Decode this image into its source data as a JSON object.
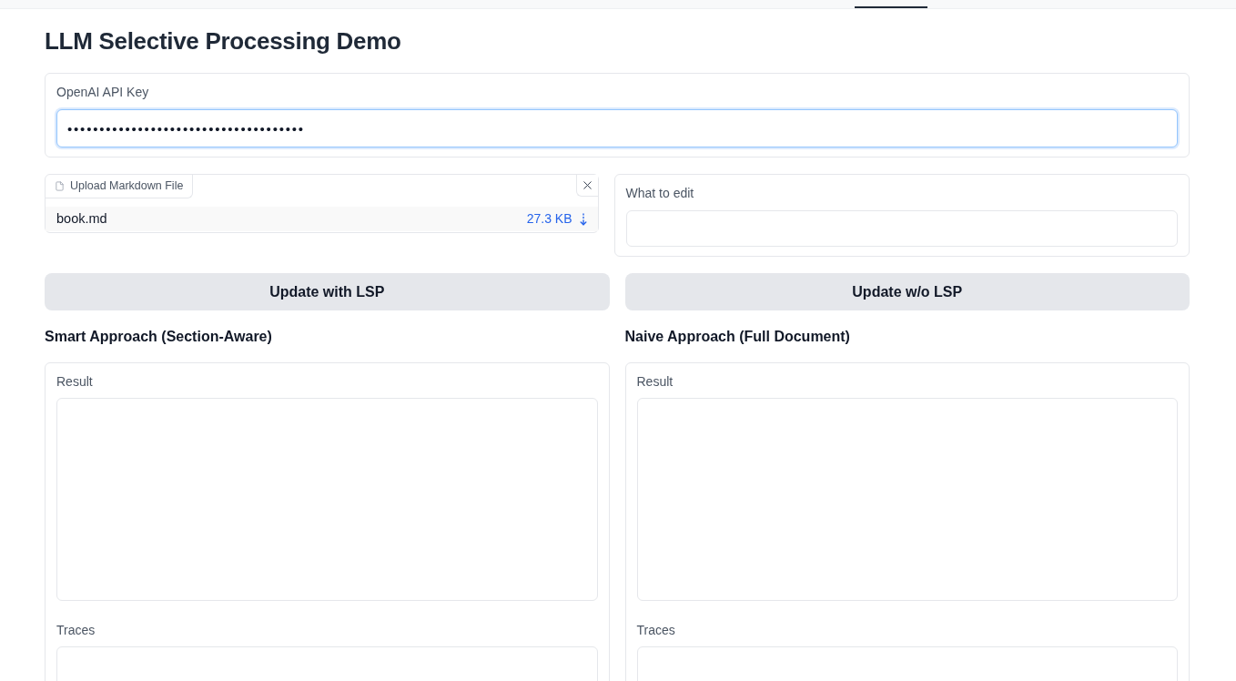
{
  "title": "LLM Selective Processing Demo",
  "api_key": {
    "label": "OpenAI API Key",
    "value": "•••••••••••••••••••••••••••••••••••••",
    "focused": true
  },
  "file_upload": {
    "label": "Upload Markdown File",
    "file_name": "book.md",
    "file_size": "27.3 KB"
  },
  "edit_instruction": {
    "label": "What to edit",
    "focused": false
  },
  "buttons": [
    "Update with LSP",
    "Update w/o LSP"
  ],
  "approaches": [
    {
      "heading": "Smart Approach (Section-Aware)",
      "fields": [
        {
          "label": "Result"
        },
        {
          "label": "Traces"
        }
      ]
    },
    {
      "heading": "Naive Approach (Full Document)",
      "fields": [
        {
          "label": "Result"
        },
        {
          "label": "Traces"
        }
      ]
    }
  ]
}
